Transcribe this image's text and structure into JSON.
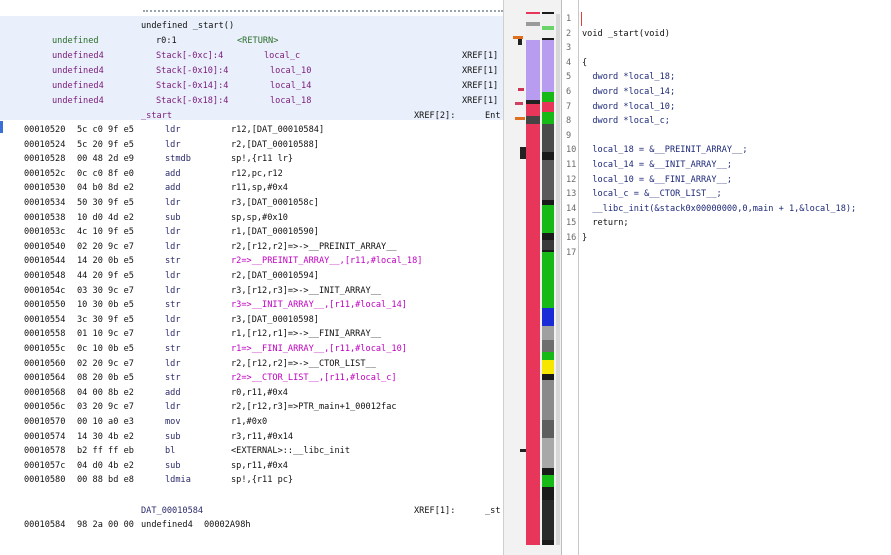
{
  "listing": {
    "header": {
      "func_signature": "undefined _start()",
      "ret_type": "undefined",
      "ret_reg": "r0:1",
      "ret_label": "<RETURN>",
      "locals": [
        {
          "type": "undefined4",
          "storage": "Stack[-0xc]:4",
          "name": "local_c",
          "xref": "XREF[1]"
        },
        {
          "type": "undefined4",
          "storage": "Stack[-0x10]:4",
          "name": "local_10",
          "xref": "XREF[1]"
        },
        {
          "type": "undefined4",
          "storage": "Stack[-0x14]:4",
          "name": "local_14",
          "xref": "XREF[1]"
        },
        {
          "type": "undefined4",
          "storage": "Stack[-0x18]:4",
          "name": "local_18",
          "xref": "XREF[1]"
        }
      ],
      "label": "_start",
      "label_xref": "XREF[2]:",
      "label_xref_tail": "Ent"
    },
    "rows": [
      {
        "addr": "00010520",
        "bytes": "5c c0 9f e5",
        "mnem": "ldr",
        "ops": "r12,[DAT_00010584]"
      },
      {
        "addr": "00010524",
        "bytes": "5c 20 9f e5",
        "mnem": "ldr",
        "ops": "r2,[DAT_00010588]"
      },
      {
        "addr": "00010528",
        "bytes": "00 48 2d e9",
        "mnem": "stmdb",
        "ops": "sp!,{r11 lr}"
      },
      {
        "addr": "0001052c",
        "bytes": "0c c0 8f e0",
        "mnem": "add",
        "ops": "r12,pc,r12"
      },
      {
        "addr": "00010530",
        "bytes": "04 b0 8d e2",
        "mnem": "add",
        "ops": "r11,sp,#0x4"
      },
      {
        "addr": "00010534",
        "bytes": "50 30 9f e5",
        "mnem": "ldr",
        "ops": "r3,[DAT_0001058c]"
      },
      {
        "addr": "00010538",
        "bytes": "10 d0 4d e2",
        "mnem": "sub",
        "ops": "sp,sp,#0x10"
      },
      {
        "addr": "0001053c",
        "bytes": "4c 10 9f e5",
        "mnem": "ldr",
        "ops": "r1,[DAT_00010590]"
      },
      {
        "addr": "00010540",
        "bytes": "02 20 9c e7",
        "mnem": "ldr",
        "ops": "r2,[r12,r2]=>->__PREINIT_ARRAY__"
      },
      {
        "addr": "00010544",
        "bytes": "14 20 0b e5",
        "mnem": "str",
        "ops": "r2=>__PREINIT_ARRAY__,[r11,#local_18]"
      },
      {
        "addr": "00010548",
        "bytes": "44 20 9f e5",
        "mnem": "ldr",
        "ops": "r2,[DAT_00010594]"
      },
      {
        "addr": "0001054c",
        "bytes": "03 30 9c e7",
        "mnem": "ldr",
        "ops": "r3,[r12,r3]=>->__INIT_ARRAY__"
      },
      {
        "addr": "00010550",
        "bytes": "10 30 0b e5",
        "mnem": "str",
        "ops": "r3=>__INIT_ARRAY__,[r11,#local_14]"
      },
      {
        "addr": "00010554",
        "bytes": "3c 30 9f e5",
        "mnem": "ldr",
        "ops": "r3,[DAT_00010598]"
      },
      {
        "addr": "00010558",
        "bytes": "01 10 9c e7",
        "mnem": "ldr",
        "ops": "r1,[r12,r1]=>->__FINI_ARRAY__"
      },
      {
        "addr": "0001055c",
        "bytes": "0c 10 0b e5",
        "mnem": "str",
        "ops": "r1=>__FINI_ARRAY__,[r11,#local_10]"
      },
      {
        "addr": "00010560",
        "bytes": "02 20 9c e7",
        "mnem": "ldr",
        "ops": "r2,[r12,r2]=>->__CTOR_LIST__"
      },
      {
        "addr": "00010564",
        "bytes": "08 20 0b e5",
        "mnem": "str",
        "ops": "r2=>__CTOR_LIST__,[r11,#local_c]"
      },
      {
        "addr": "00010568",
        "bytes": "04 00 8b e2",
        "mnem": "add",
        "ops": "r0,r11,#0x4"
      },
      {
        "addr": "0001056c",
        "bytes": "03 20 9c e7",
        "mnem": "ldr",
        "ops": "r2,[r12,r3]=>PTR_main+1_00012fac"
      },
      {
        "addr": "00010570",
        "bytes": "00 10 a0 e3",
        "mnem": "mov",
        "ops": "r1,#0x0"
      },
      {
        "addr": "00010574",
        "bytes": "14 30 4b e2",
        "mnem": "sub",
        "ops": "r3,r11,#0x14"
      },
      {
        "addr": "00010578",
        "bytes": "b2 ff ff eb",
        "mnem": "bl",
        "ops": "<EXTERNAL>::__libc_init"
      },
      {
        "addr": "0001057c",
        "bytes": "04 d0 4b e2",
        "mnem": "sub",
        "ops": "sp,r11,#0x4"
      },
      {
        "addr": "00010580",
        "bytes": "00 88 bd e8",
        "mnem": "ldmia",
        "ops": "sp!,{r11 pc}"
      }
    ],
    "data_label": "DAT_00010584",
    "data_xref": "XREF[1]:",
    "data_xref_tail": "_st",
    "data_row": {
      "addr": "00010584",
      "bytes": "98 2a 00 00",
      "mnem": "undefined4",
      "ops": "00002A98h"
    }
  },
  "decompiler": {
    "lines": [
      {
        "n": "1",
        "text": ""
      },
      {
        "n": "2",
        "text": "void _start(void)"
      },
      {
        "n": "3",
        "text": ""
      },
      {
        "n": "4",
        "text": "{"
      },
      {
        "n": "5",
        "text": "  dword *local_18;"
      },
      {
        "n": "6",
        "text": "  dword *local_14;"
      },
      {
        "n": "7",
        "text": "  dword *local_10;"
      },
      {
        "n": "8",
        "text": "  dword *local_c;"
      },
      {
        "n": "9",
        "text": ""
      },
      {
        "n": "10",
        "text": "  local_18 = &__PREINIT_ARRAY__;"
      },
      {
        "n": "11",
        "text": "  local_14 = &__INIT_ARRAY__;"
      },
      {
        "n": "12",
        "text": "  local_10 = &__FINI_ARRAY__;"
      },
      {
        "n": "13",
        "text": "  local_c = &__CTOR_LIST__;"
      },
      {
        "n": "14",
        "text": "  __libc_init(&stack0x00000000,0,main + 1,&local_18);"
      },
      {
        "n": "15",
        "text": "  return;"
      },
      {
        "n": "16",
        "text": "}"
      },
      {
        "n": "17",
        "text": ""
      }
    ]
  },
  "colors": {
    "overview_code": "#e8355a",
    "overview_data": "#17b917",
    "overview_purple": "#b79cf0",
    "overview_black": "#222222",
    "overview_blue": "#1a2ad6",
    "overview_yellow": "#f7e600",
    "overview_gray": "#8a8a8a"
  }
}
